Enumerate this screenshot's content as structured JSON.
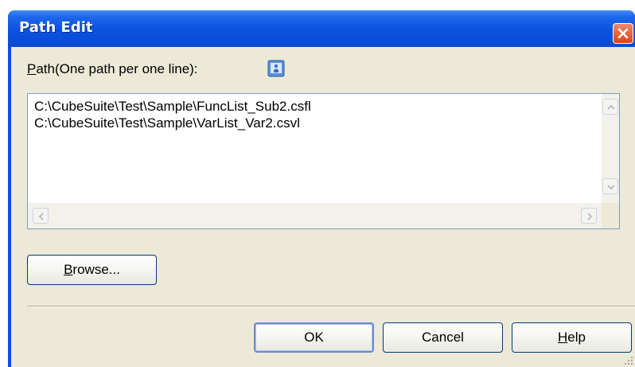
{
  "window": {
    "title": "Path Edit"
  },
  "path_label": {
    "mnemonic": "P",
    "rest": "ath(One path per one line):"
  },
  "path_lines": [
    "C:\\CubeSuite\\Test\\Sample\\FuncList_Sub2.csfl",
    "C:\\CubeSuite\\Test\\Sample\\VarList_Var2.csvl"
  ],
  "buttons": {
    "browse": {
      "mnemonic": "B",
      "rest": "rowse..."
    },
    "ok": "OK",
    "cancel": "Cancel",
    "help": {
      "mnemonic": "H",
      "rest": "elp"
    }
  },
  "icons": {
    "close": "close-icon",
    "info": "info-icon"
  },
  "colors": {
    "title_bar": "#0a52df",
    "dialog_face": "#ece9d8",
    "close_button": "#d9421e"
  }
}
